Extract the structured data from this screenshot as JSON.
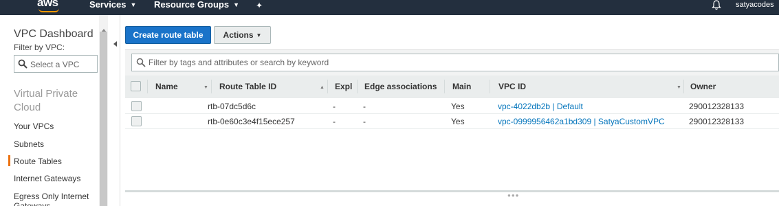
{
  "nav": {
    "logo": "aws",
    "services": "Services",
    "resource_groups": "Resource Groups",
    "user": "satyacodes"
  },
  "sidebar": {
    "title": "VPC Dashboard",
    "filter_label": "Filter by VPC:",
    "select_placeholder": "Select a VPC",
    "section": "Virtual Private Cloud",
    "items": [
      {
        "label": "Your VPCs"
      },
      {
        "label": "Subnets"
      },
      {
        "label": "Route Tables"
      },
      {
        "label": "Internet Gateways"
      },
      {
        "label": "Egress Only Internet Gateways"
      }
    ]
  },
  "toolbar": {
    "create_label": "Create route table",
    "actions_label": "Actions"
  },
  "search": {
    "placeholder": "Filter by tags and attributes or search by keyword"
  },
  "table": {
    "columns": [
      "Name",
      "Route Table ID",
      "Expl",
      "Edge associations",
      "Main",
      "VPC ID",
      "Owner"
    ],
    "rows": [
      {
        "name": "",
        "route_table_id": "rtb-07dc5d6c",
        "explicit": "-",
        "edge": "-",
        "main": "Yes",
        "vpc_id": "vpc-4022db2b | Default",
        "owner": "290012328133"
      },
      {
        "name": "",
        "route_table_id": "rtb-0e60c3e4f15ece257",
        "explicit": "-",
        "edge": "-",
        "main": "Yes",
        "vpc_id": "vpc-0999956462a1bd309 | SatyaCustomVPC",
        "owner": "290012328133"
      }
    ]
  },
  "colors": {
    "nav_bg": "#232f3e",
    "primary": "#1a73c9",
    "accent": "#ec7211",
    "link": "#0073bb"
  }
}
